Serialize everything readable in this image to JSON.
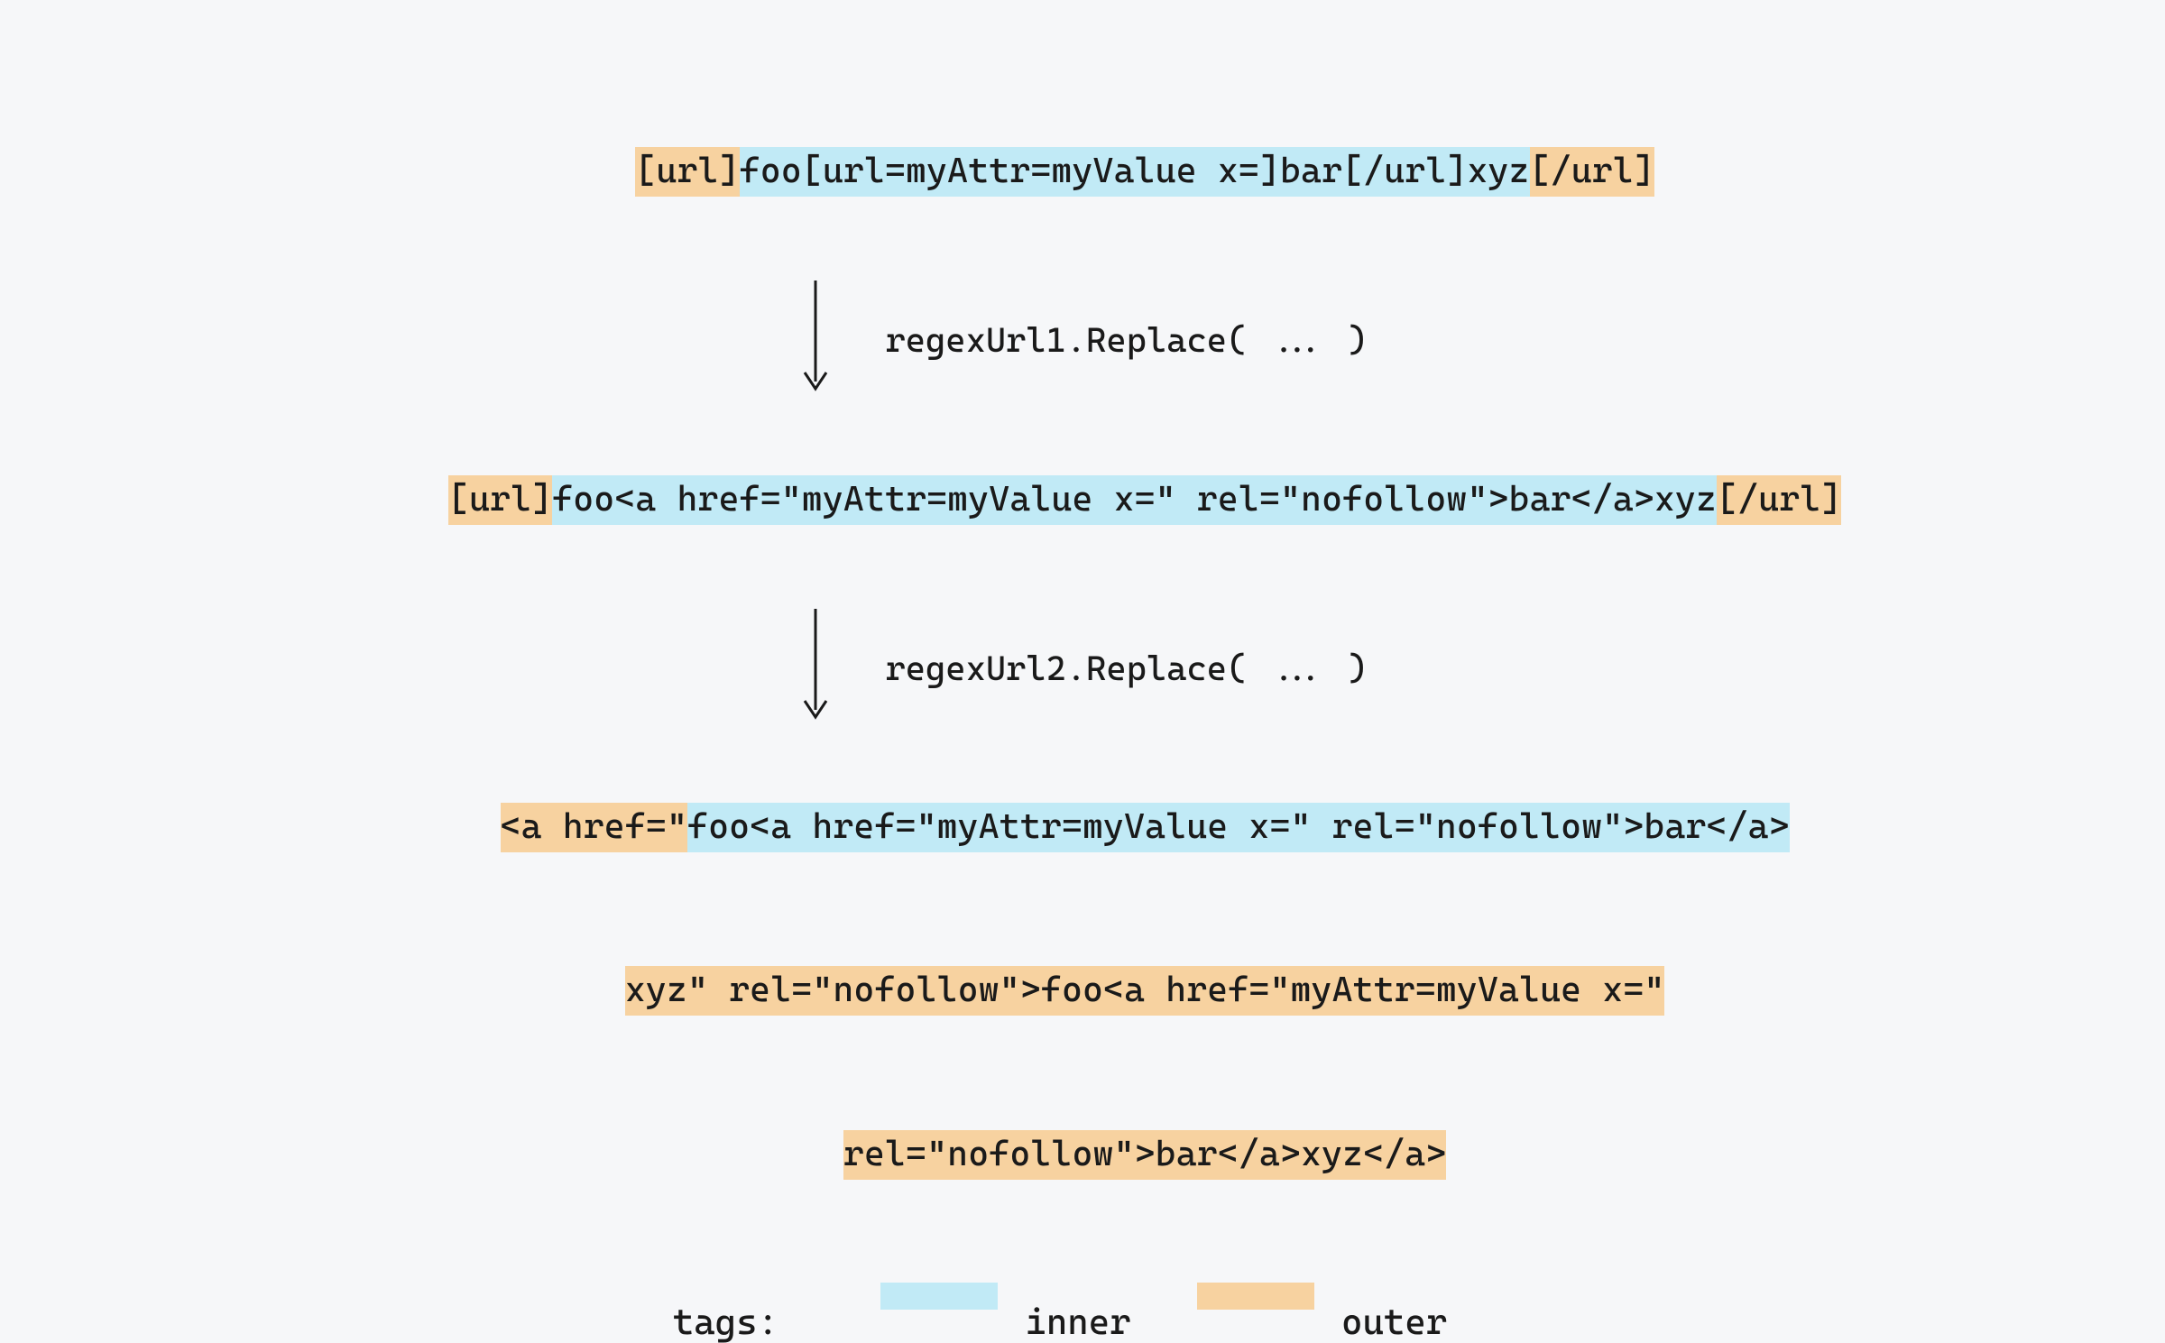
{
  "colors": {
    "inner": "#c1eaf6",
    "outer": "#f7d2a0",
    "bg": "#f6f7f9"
  },
  "stages": {
    "s1": {
      "segments": [
        {
          "cls": "outer",
          "text": "[url]"
        },
        {
          "cls": "inner",
          "text": "foo[url=myAttr=myValue x=]bar[/url]xyz"
        },
        {
          "cls": "outer",
          "text": "[/url]"
        }
      ]
    },
    "s2": {
      "segments": [
        {
          "cls": "outer",
          "text": "[url]"
        },
        {
          "cls": "inner",
          "text": "foo<a href=\"myAttr=myValue x=\" rel=\"nofollow\">bar</a>xyz"
        },
        {
          "cls": "outer",
          "text": "[/url]"
        }
      ]
    },
    "s3": {
      "lines": [
        [
          {
            "cls": "outer",
            "text": "<a href=\""
          },
          {
            "cls": "inner",
            "text": "foo<a href=\"myAttr=myValue x=\" rel=\"nofollow\">bar</a>"
          }
        ],
        [
          {
            "cls": "outer",
            "text": "xyz\" rel=\"nofollow\">foo<a href=\"myAttr=myValue x=\""
          }
        ],
        [
          {
            "cls": "outer",
            "text": "rel=\"nofollow\">bar</a>xyz</a>"
          }
        ]
      ]
    }
  },
  "arrows": {
    "a1": {
      "label": "regexUrl1.Replace( ... )"
    },
    "a2": {
      "label": "regexUrl2.Replace( ... )"
    }
  },
  "legend": {
    "title": "tags:",
    "inner": "inner",
    "outer": "outer"
  }
}
